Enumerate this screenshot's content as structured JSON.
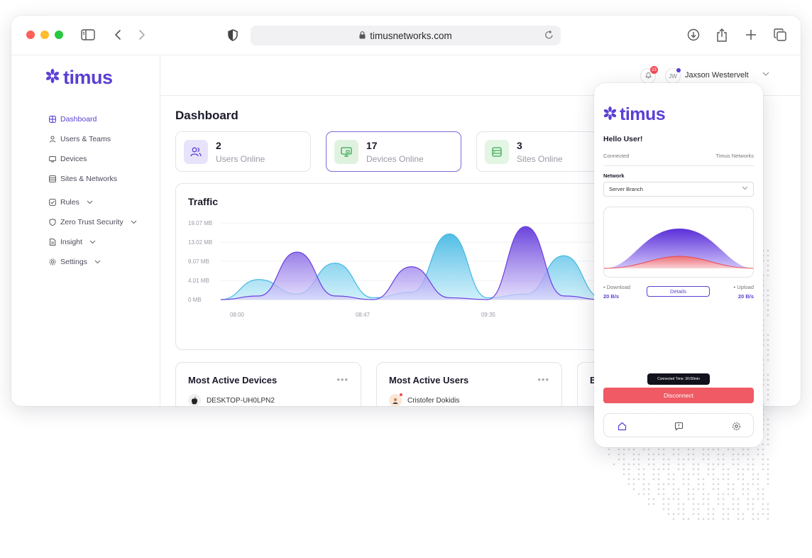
{
  "browser": {
    "url": "timusnetworks.com"
  },
  "brand": {
    "name": "timus",
    "accent": "#5b3fd4"
  },
  "sidebar": {
    "items": [
      {
        "label": "Dashboard",
        "icon": "dashboard-icon",
        "active": true
      },
      {
        "label": "Users & Teams",
        "icon": "users-icon"
      },
      {
        "label": "Devices",
        "icon": "devices-icon"
      },
      {
        "label": "Sites & Networks",
        "icon": "sites-icon"
      },
      {
        "label": "Rules",
        "icon": "rules-icon",
        "expandable": true
      },
      {
        "label": "Zero Trust Security",
        "icon": "shield-icon",
        "expandable": true
      },
      {
        "label": "Insight",
        "icon": "insight-icon",
        "expandable": true
      },
      {
        "label": "Settings",
        "icon": "settings-icon",
        "expandable": true
      }
    ]
  },
  "header": {
    "notification_count": "23",
    "avatar_initials": "JW",
    "user_name": "Jaxson Westervelt"
  },
  "main": {
    "title": "Dashboard",
    "stats": [
      {
        "value": "2",
        "label": "Users Online",
        "icon": "users-icon",
        "color": "#5b3fd4"
      },
      {
        "value": "17",
        "label": "Devices Online",
        "icon": "monitor-icon",
        "color": "#3aa655"
      },
      {
        "value": "3",
        "label": "Sites Online",
        "icon": "server-icon",
        "color": "#3aa655"
      }
    ],
    "traffic_title": "Traffic",
    "cards": [
      {
        "title": "Most Active Devices",
        "more": "•••",
        "first_row": "DESKTOP-UH0LPN2",
        "row_icon": "apple-icon"
      },
      {
        "title": "Most Active Users",
        "more": "•••",
        "first_row": "Cristofer Dokidis",
        "row_icon": "user-avatar"
      },
      {
        "title": "E"
      }
    ]
  },
  "chart_data": {
    "type": "area",
    "title": "Traffic",
    "y_ticks": [
      "19.07 MB",
      "13.02 MB",
      "9.07 MB",
      "4.01 MB",
      "0 MB"
    ],
    "x_ticks": [
      "08:00",
      "08:47",
      "09:35"
    ],
    "series": [
      {
        "color": "#42b9e4",
        "values": [
          0,
          1.1,
          0.3,
          2.0,
          0.1,
          0.4,
          3.6,
          0.1,
          0.3,
          2.4,
          0.1
        ]
      },
      {
        "color": "#6b3fe0",
        "values": [
          0,
          0.2,
          2.6,
          0.2,
          0.0,
          1.8,
          0.1,
          0.0,
          4.0,
          0.2,
          0.0
        ]
      }
    ]
  },
  "mobile": {
    "brand": "timus",
    "greeting": "Hello User!",
    "status": "Connected",
    "provider": "Timus Networks",
    "network_label": "Network",
    "network_value": "Server Branch",
    "download_label": "• Download",
    "download_value": "20 B/s",
    "upload_label": "• Upload",
    "upload_value": "20 B/s",
    "details_label": "Details",
    "connected_time": "Connected Time: 30:00min",
    "disconnect_label": "Disconnect",
    "tabs": [
      "home-icon",
      "support-icon",
      "settings-icon"
    ]
  }
}
